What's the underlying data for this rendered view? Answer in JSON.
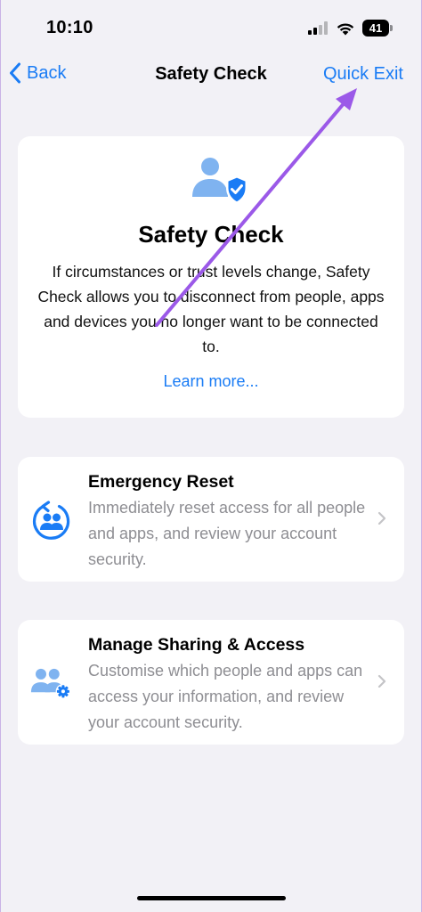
{
  "status_bar": {
    "time": "10:10",
    "battery": "41",
    "icons": [
      "signal-icon",
      "wifi-icon",
      "battery-icon"
    ]
  },
  "nav": {
    "back_label": "Back",
    "title": "Safety Check",
    "quick_exit_label": "Quick Exit"
  },
  "hero": {
    "icon": "person-shield-icon",
    "title": "Safety Check",
    "description": "If circumstances or trust levels change, Safety Check allows you to disconnect from people, apps and devices you no longer want to be connected to.",
    "link": "Learn more..."
  },
  "options": [
    {
      "icon": "reset-people-icon",
      "title": "Emergency Reset",
      "description": "Immediately reset access for all people and apps, and review your account security."
    },
    {
      "icon": "people-gear-icon",
      "title": "Manage Sharing & Access",
      "description": "Customise which people and apps can access your information, and review your account security."
    }
  ],
  "colors": {
    "accent": "#1a7cf5",
    "background": "#f2f1f6",
    "card": "#ffffff",
    "secondary_text": "#8e8e93",
    "icon_light_blue": "#7fb3f0",
    "annotation_arrow": "#9b59e8"
  }
}
